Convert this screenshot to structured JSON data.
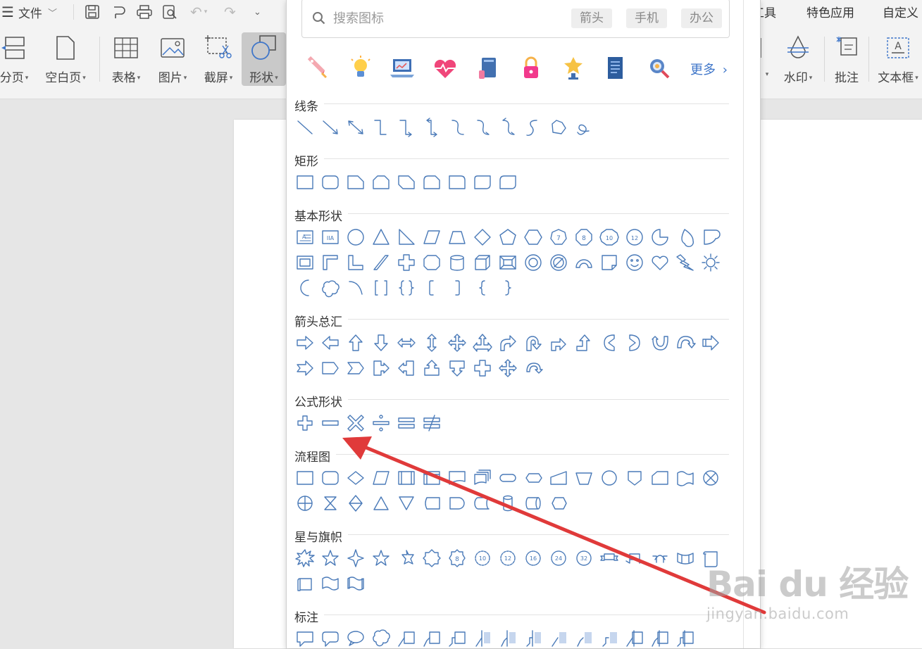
{
  "ribbon": {
    "menu_label": "文件",
    "tools_left": [
      {
        "key": "page_break",
        "label": "分页"
      },
      {
        "key": "blank_page",
        "label": "空白页"
      },
      {
        "key": "table",
        "label": "表格"
      },
      {
        "key": "picture",
        "label": "图片"
      },
      {
        "key": "screenshot",
        "label": "截屏"
      },
      {
        "key": "shape",
        "label": "形状"
      }
    ],
    "tools_right": [
      {
        "key": "watermark",
        "label": "水印"
      },
      {
        "key": "comment",
        "label": "批注"
      },
      {
        "key": "textbox",
        "label": "文本框"
      }
    ],
    "top_tabs": [
      "工具",
      "特色应用",
      "自定义"
    ]
  },
  "panel": {
    "search_placeholder": "搜索图标",
    "tags": [
      "箭头",
      "手机",
      "办公"
    ],
    "icon_categories": [
      "rocket-icon",
      "lightbulb-icon",
      "laptop-chart-icon",
      "heart-pulse-icon",
      "phone-book-icon",
      "padlock-icon",
      "trophy-icon",
      "document-icon",
      "magnifier-gear-icon"
    ],
    "more_label": "更多",
    "sections": [
      {
        "key": "lines",
        "title": "线条"
      },
      {
        "key": "rectangles",
        "title": "矩形"
      },
      {
        "key": "basic",
        "title": "基本形状"
      },
      {
        "key": "arrows",
        "title": "箭头总汇"
      },
      {
        "key": "formula",
        "title": "公式形状"
      },
      {
        "key": "flowchart",
        "title": "流程图"
      },
      {
        "key": "stars",
        "title": "星与旗帜"
      },
      {
        "key": "callouts",
        "title": "标注"
      }
    ],
    "basic_number_labels": [
      "7",
      "8",
      "10",
      "12"
    ],
    "star_number_labels": [
      "8",
      "10",
      "12",
      "16",
      "24",
      "32"
    ]
  },
  "watermark": {
    "logo": "Bai du 经验",
    "url": "jingyan.baidu.com"
  },
  "colors": {
    "shape_stroke": "#4a7ab8",
    "arrow": "#e03a3a",
    "accent_link": "#3f76c9"
  }
}
